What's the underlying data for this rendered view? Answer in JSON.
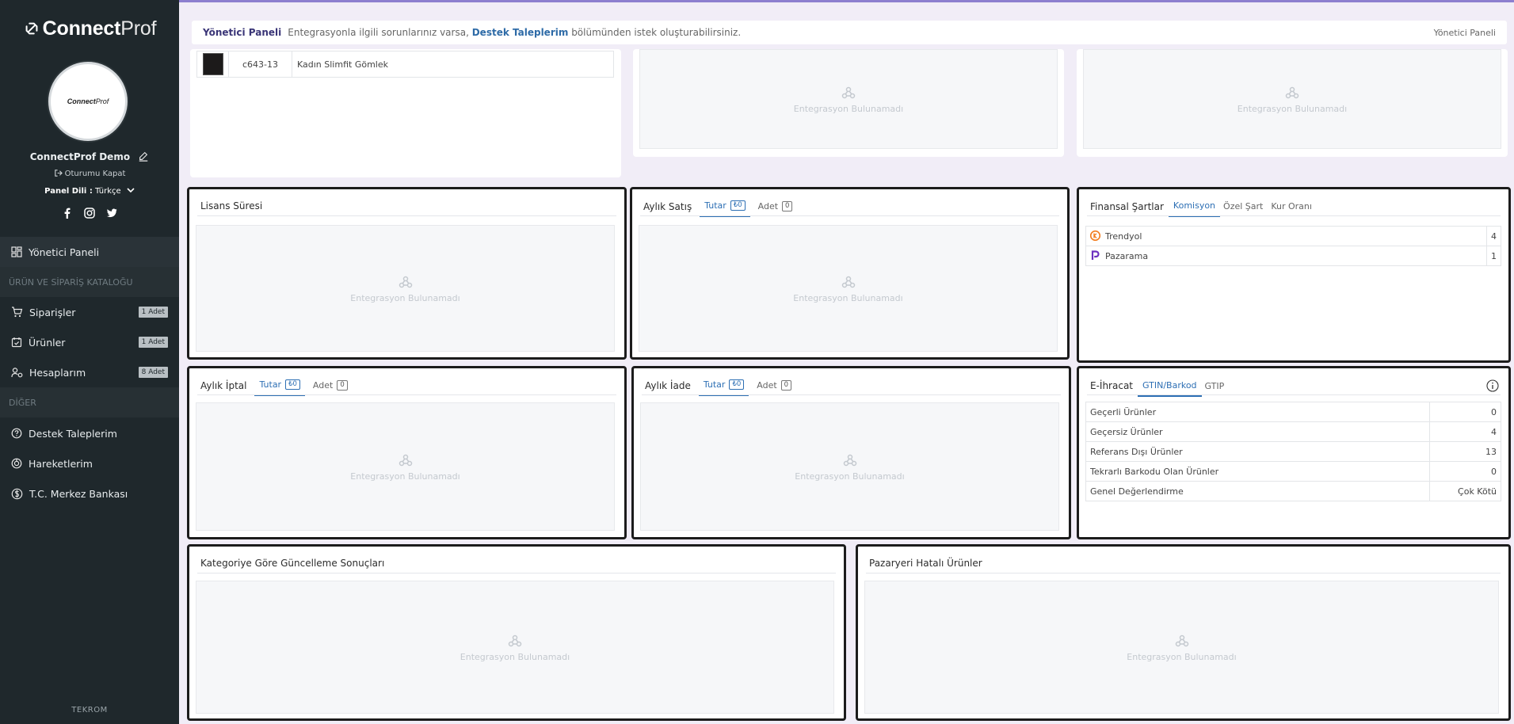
{
  "brand": {
    "bold": "Connect",
    "light": "Prof"
  },
  "avatar": {
    "bold": "Connect",
    "light": "Prof"
  },
  "user": {
    "name": "ConnectProf Demo",
    "logout": "Oturumu Kapat"
  },
  "lang": {
    "label": "Panel Dili :",
    "value": "Türkçe"
  },
  "menu": {
    "dashboard": "Yönetici Paneli",
    "section_catalog": "ÜRÜN VE SİPARİŞ KATALOĞU",
    "orders": "Siparişler",
    "orders_badge": "1 Adet",
    "products": "Ürünler",
    "products_badge": "1 Adet",
    "accounts": "Hesaplarım",
    "accounts_badge": "8 Adet",
    "section_other": "DİĞER",
    "support": "Destek Taleplerim",
    "movements": "Hareketlerim",
    "central_bank": "T.C. Merkez Bankası"
  },
  "footer": "TEKROM",
  "header": {
    "title": "Yönetici Paneli",
    "message_pre": "Entegrasyonla ilgili sorunlarınız varsa,",
    "link": "Destek Taleplerim",
    "message_post": "bölümünden istek oluşturabilirsiniz.",
    "breadcrumb": "Yönetici Paneli"
  },
  "product_row": {
    "code": "c643-13",
    "name": "Kadın Slimfit Gömlek"
  },
  "empty_text": "Entegrasyon Bulunamadı",
  "license": {
    "title": "Lisans Süresi"
  },
  "monthly_sales": {
    "title": "Aylık Satış",
    "tab_amount": "Tutar",
    "amount_count": "₺0",
    "tab_qty": "Adet",
    "qty_count": "0"
  },
  "monthly_cancel": {
    "title": "Aylık İptal",
    "tab_amount": "Tutar",
    "amount_count": "₺0",
    "tab_qty": "Adet",
    "qty_count": "0"
  },
  "monthly_return": {
    "title": "Aylık İade",
    "tab_amount": "Tutar",
    "amount_count": "₺0",
    "tab_qty": "Adet",
    "qty_count": "0"
  },
  "finance": {
    "title": "Finansal Şartlar",
    "tabs": [
      "Komisyon",
      "Özel Şart",
      "Kur Oranı"
    ],
    "rows": [
      {
        "name": "Trendyol",
        "value": "4"
      },
      {
        "name": "Pazarama",
        "value": "1"
      }
    ]
  },
  "export": {
    "title": "E-İhracat",
    "tabs": [
      "GTIN/Barkod",
      "GTIP"
    ],
    "rows": [
      {
        "label": "Geçerli Ürünler",
        "value": "0"
      },
      {
        "label": "Geçersiz Ürünler",
        "value": "4"
      },
      {
        "label": "Referans Dışı Ürünler",
        "value": "13"
      },
      {
        "label": "Tekrarlı Barkodu Olan Ürünler",
        "value": "0"
      },
      {
        "label": "Genel Değerlendirme",
        "value": "Çok Kötü"
      }
    ]
  },
  "category_updates": {
    "title": "Kategoriye Göre Güncelleme Sonuçları"
  },
  "marketplace_errors": {
    "title": "Pazaryeri Hatalı Ürünler"
  },
  "colors": {
    "sidebar": "#1f282c",
    "accent": "#2d6fb4",
    "brand_purple": "#3a3577"
  }
}
